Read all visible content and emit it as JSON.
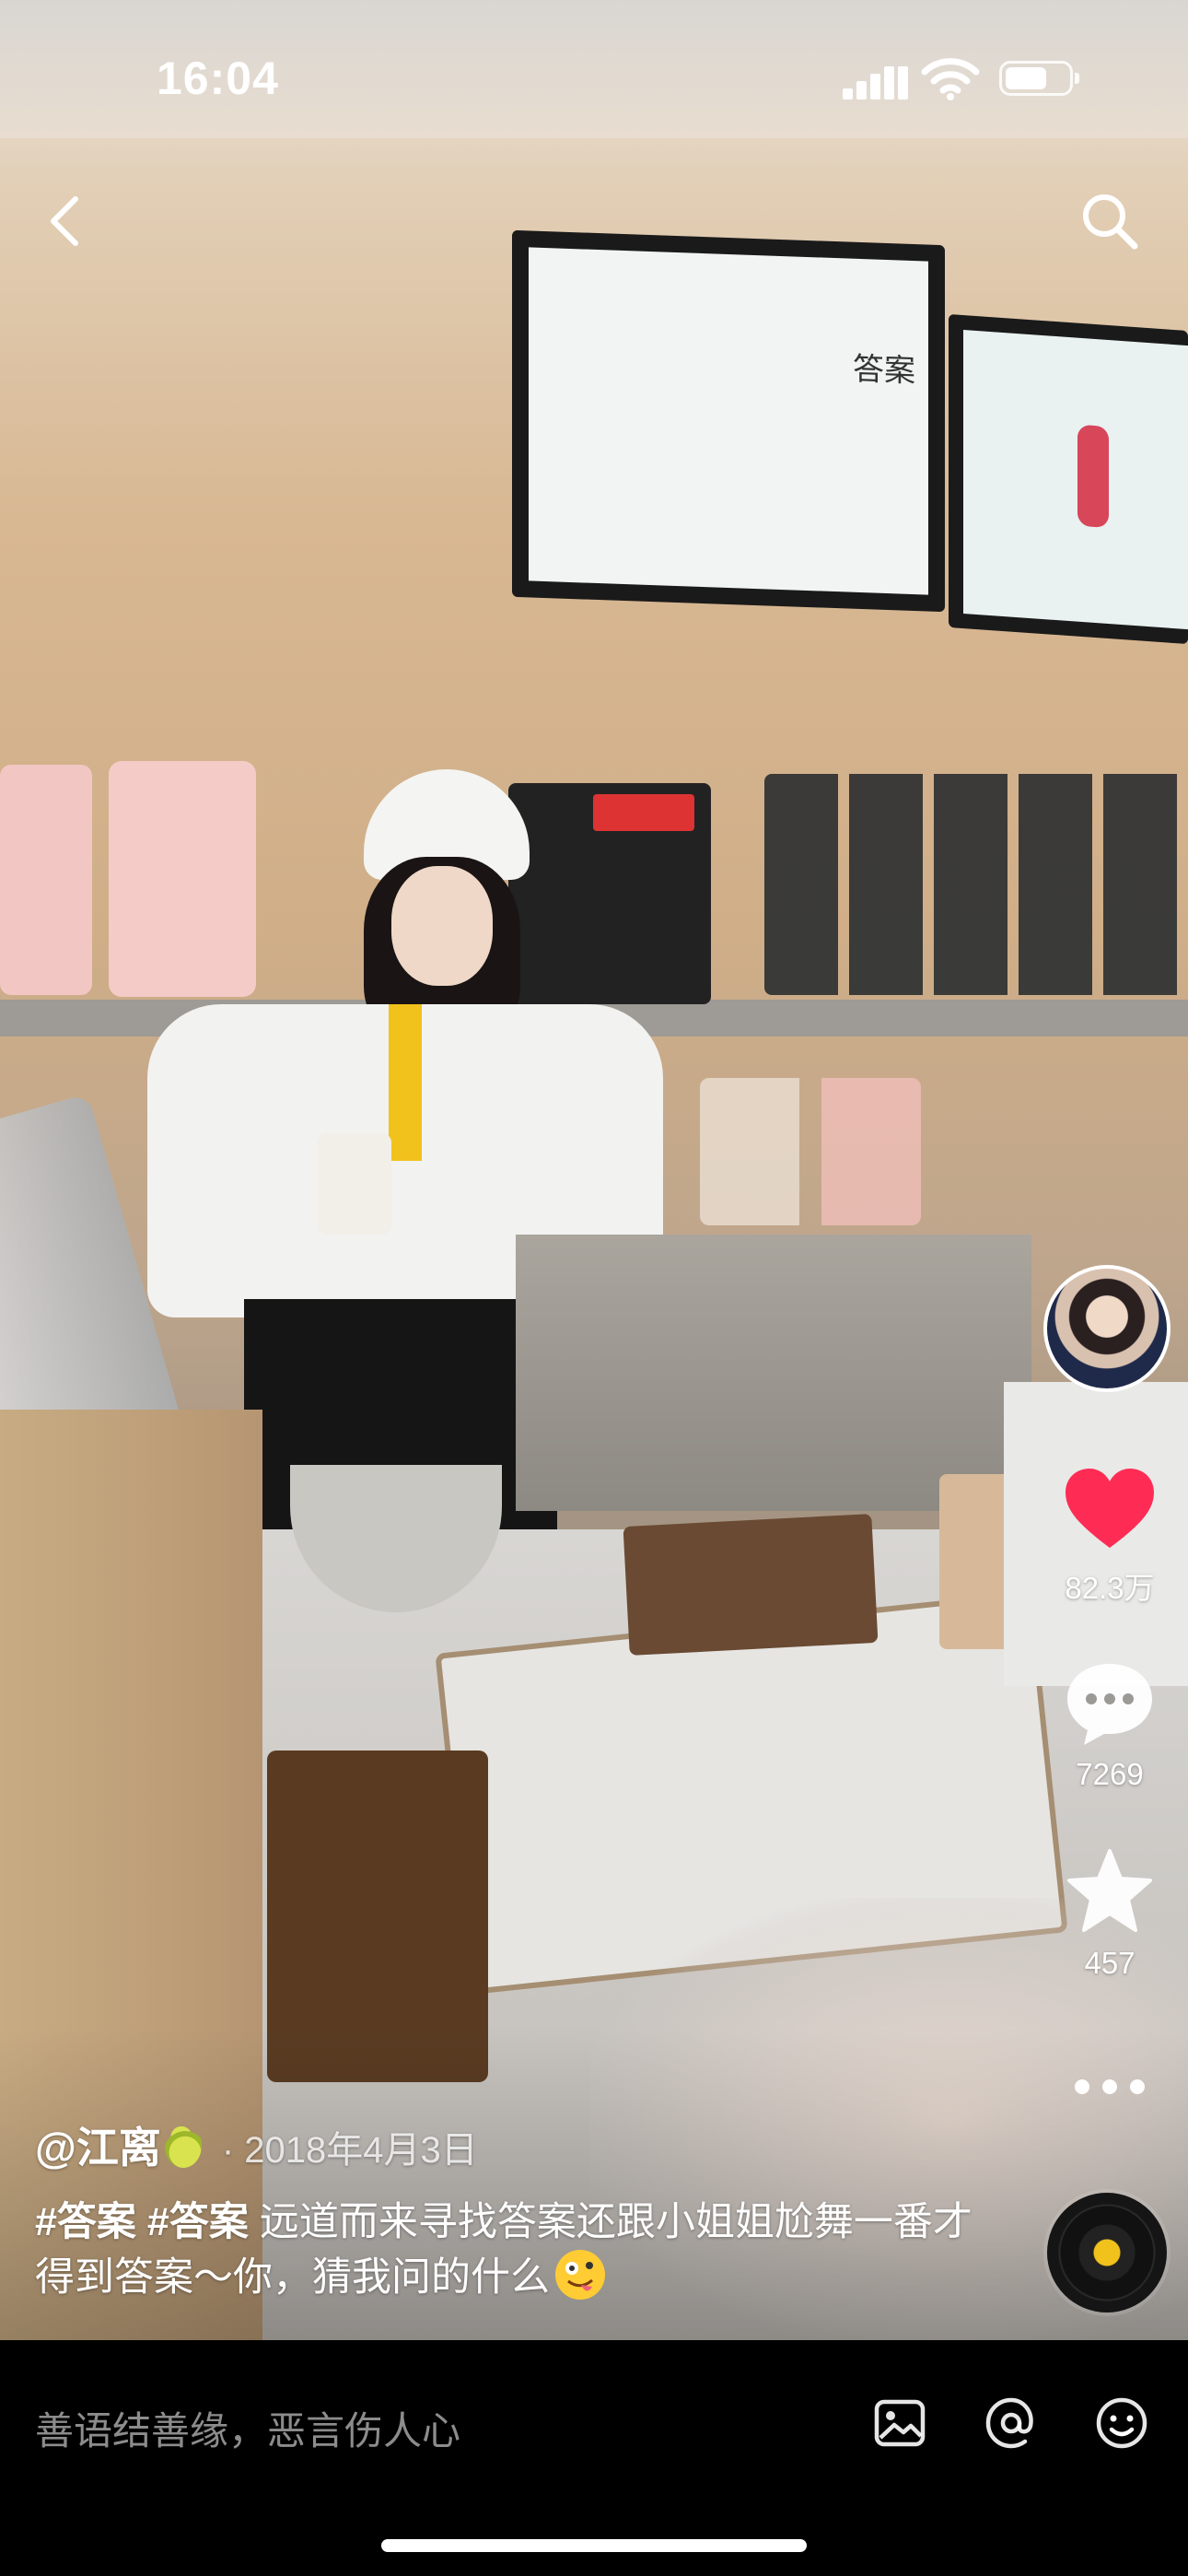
{
  "status_bar": {
    "time": "16:04"
  },
  "video": {
    "author": "@江离",
    "author_badge": "pear-emoji",
    "date": "· 2018年4月3日",
    "hashtags": [
      "#答案",
      "#答案"
    ],
    "description": "远道而来寻找答案还跟小姐姐尬舞一番才得到答案～你，猜我问的什么",
    "description_emoji": "zany-face-emoji",
    "shop_sign_text": "答案"
  },
  "actions": {
    "likes": "82.3万",
    "comments": "7269",
    "favorites": "457"
  },
  "comment_bar": {
    "placeholder": "善语结善缘，恶言伤人心"
  },
  "icons": [
    "back-icon",
    "search-icon",
    "heart-icon",
    "comment-icon",
    "star-icon",
    "more-icon",
    "music-disc-icon",
    "image-icon",
    "at-icon",
    "emoji-icon"
  ],
  "colors": {
    "like": "#fe2c55",
    "disc_center": "#f1c21b"
  }
}
